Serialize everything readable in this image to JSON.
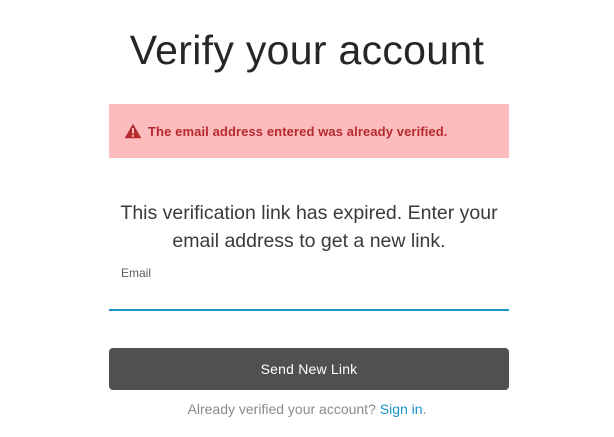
{
  "page": {
    "title": "Verify your account"
  },
  "alert": {
    "icon": "warning-triangle-icon",
    "message": "The email address entered was already verified.",
    "background_color": "#fcbcbd",
    "text_color": "#b52a2f"
  },
  "instructions": {
    "text": "This verification link has expired. Enter your email address to get a new link."
  },
  "email_field": {
    "label": "Email",
    "value": "",
    "accent_color": "#1b95c9"
  },
  "send_button": {
    "label": "Send New Link",
    "background_color": "#505050"
  },
  "footer": {
    "prompt": "Already verified your account?",
    "link_label": "Sign in",
    "suffix": "."
  }
}
